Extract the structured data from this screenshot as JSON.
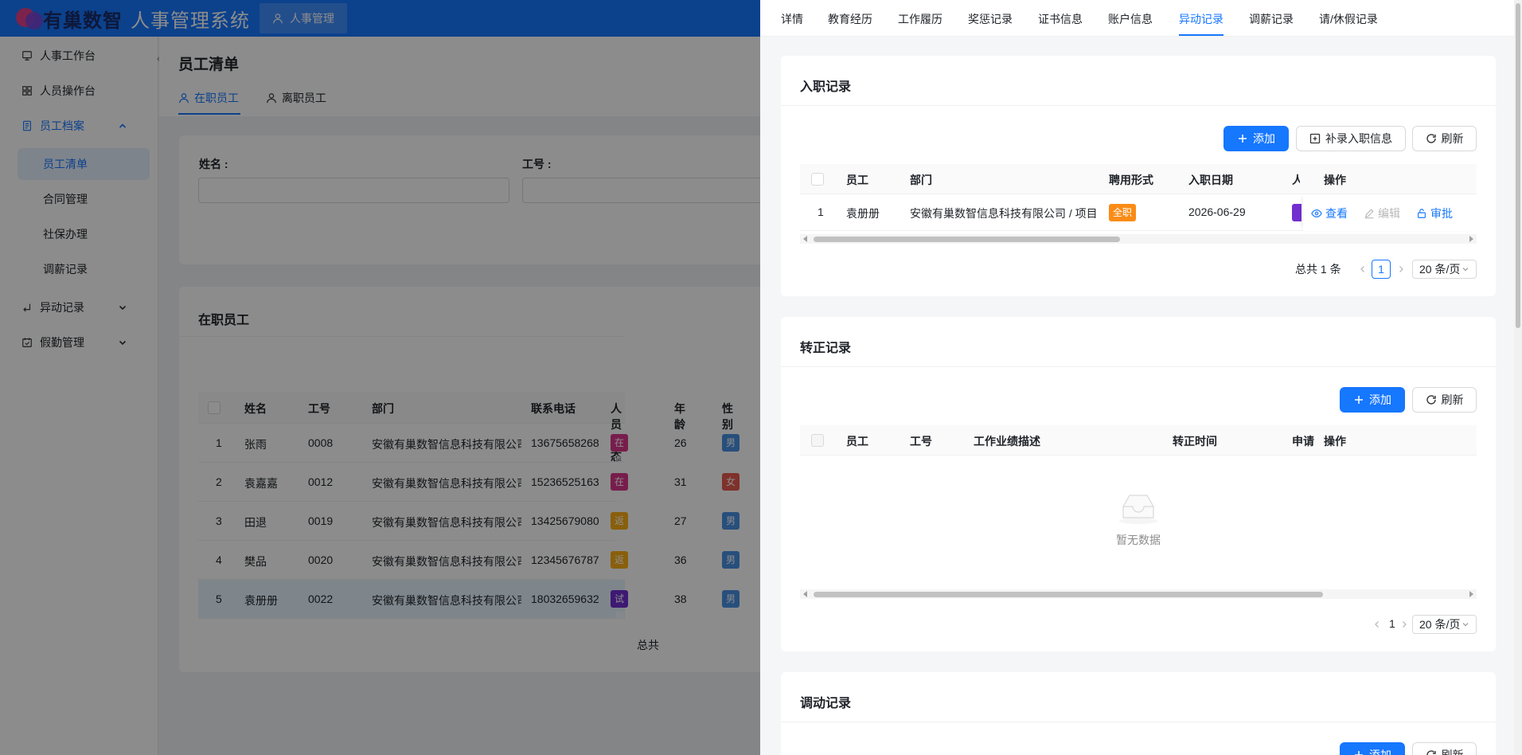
{
  "header": {
    "logo_text": "有巢数智",
    "system_title": "人事管理系统",
    "module_tab": "人事管理",
    "accent": "#1677ff"
  },
  "sidebar": {
    "items": [
      {
        "label": "人事工作台",
        "icon": "desktop-icon"
      },
      {
        "label": "人员操作台",
        "icon": "grid-icon"
      },
      {
        "label": "员工档案",
        "icon": "profile-icon"
      },
      {
        "label": "异动记录",
        "icon": "return-icon"
      },
      {
        "label": "假勤管理",
        "icon": "calendar-check-icon"
      }
    ],
    "sub_items": [
      "员工清单",
      "合同管理",
      "社保办理",
      "调薪记录"
    ]
  },
  "page": {
    "title": "员工清单",
    "tabs": [
      "在职员工",
      "离职员工"
    ],
    "filters": {
      "name_label": "姓名 :",
      "id_label": "工号 :"
    },
    "list_title": "在职员工",
    "columns": [
      "姓名",
      "工号",
      "部门",
      "联系电话",
      "人员状态",
      "年龄",
      "性别"
    ],
    "rows": [
      {
        "idx": "1",
        "name": "张雨",
        "id": "0008",
        "dept": "安徽有巢数智信息科技有限公司",
        "phone": "13675658268",
        "status": "在职",
        "age": "26",
        "gender": "男"
      },
      {
        "idx": "2",
        "name": "袁嘉嘉",
        "id": "0012",
        "dept": "安徽有巢数智信息科技有限公司",
        "phone": "15236525163",
        "status": "在职",
        "age": "31",
        "gender": "女"
      },
      {
        "idx": "3",
        "name": "田退",
        "id": "0019",
        "dept": "安徽有巢数智信息科技有限公司",
        "phone": "13425679080",
        "status": "返聘",
        "age": "27",
        "gender": "男"
      },
      {
        "idx": "4",
        "name": "樊品",
        "id": "0020",
        "dept": "安徽有巢数智信息科技有限公司",
        "phone": "12345676787",
        "status": "返聘",
        "age": "36",
        "gender": "男"
      },
      {
        "idx": "5",
        "name": "袁册册",
        "id": "0022",
        "dept": "安徽有巢数智信息科技有限公司",
        "phone": "18032659632",
        "status": "试用",
        "age": "38",
        "gender": "男"
      }
    ],
    "total_prefix": "总共"
  },
  "drawer": {
    "tabs": [
      "详情",
      "教育经历",
      "工作履历",
      "奖惩记录",
      "证书信息",
      "账户信息",
      "异动记录",
      "调薪记录",
      "请/休假记录"
    ],
    "onboard": {
      "title": "入职记录",
      "btn_add": "添加",
      "btn_supplement": "补录入职信息",
      "btn_refresh": "刷新",
      "columns": [
        "员工",
        "部门",
        "聘用形式",
        "入职日期",
        "人",
        "操作"
      ],
      "row": {
        "idx": "1",
        "employee": "袁册册",
        "dept": "安徽有巢数智信息科技有限公司 / 项目",
        "type": "全职",
        "date": "2026-06-29"
      },
      "actions": [
        "查看",
        "编辑",
        "审批"
      ],
      "total": "总共 1 条",
      "page": "1",
      "page_size": "20 条/页"
    },
    "regular": {
      "title": "转正记录",
      "btn_add": "添加",
      "btn_refresh": "刷新",
      "columns": [
        "员工",
        "工号",
        "工作业绩描述",
        "转正时间",
        "申请",
        "操作"
      ],
      "empty": "暂无数据",
      "page": "1",
      "page_size": "20 条/页"
    },
    "transfer": {
      "title": "调动记录",
      "btn_add": "添加",
      "btn_refresh": "刷新"
    }
  },
  "colors": {
    "tag_active": "#d9368b",
    "tag_rehire": "#faad14",
    "tag_trial": "#722ed1",
    "tag_male": "#4a90e2",
    "tag_female": "#e85a4f",
    "tag_fulltime": "#fa8c16"
  }
}
